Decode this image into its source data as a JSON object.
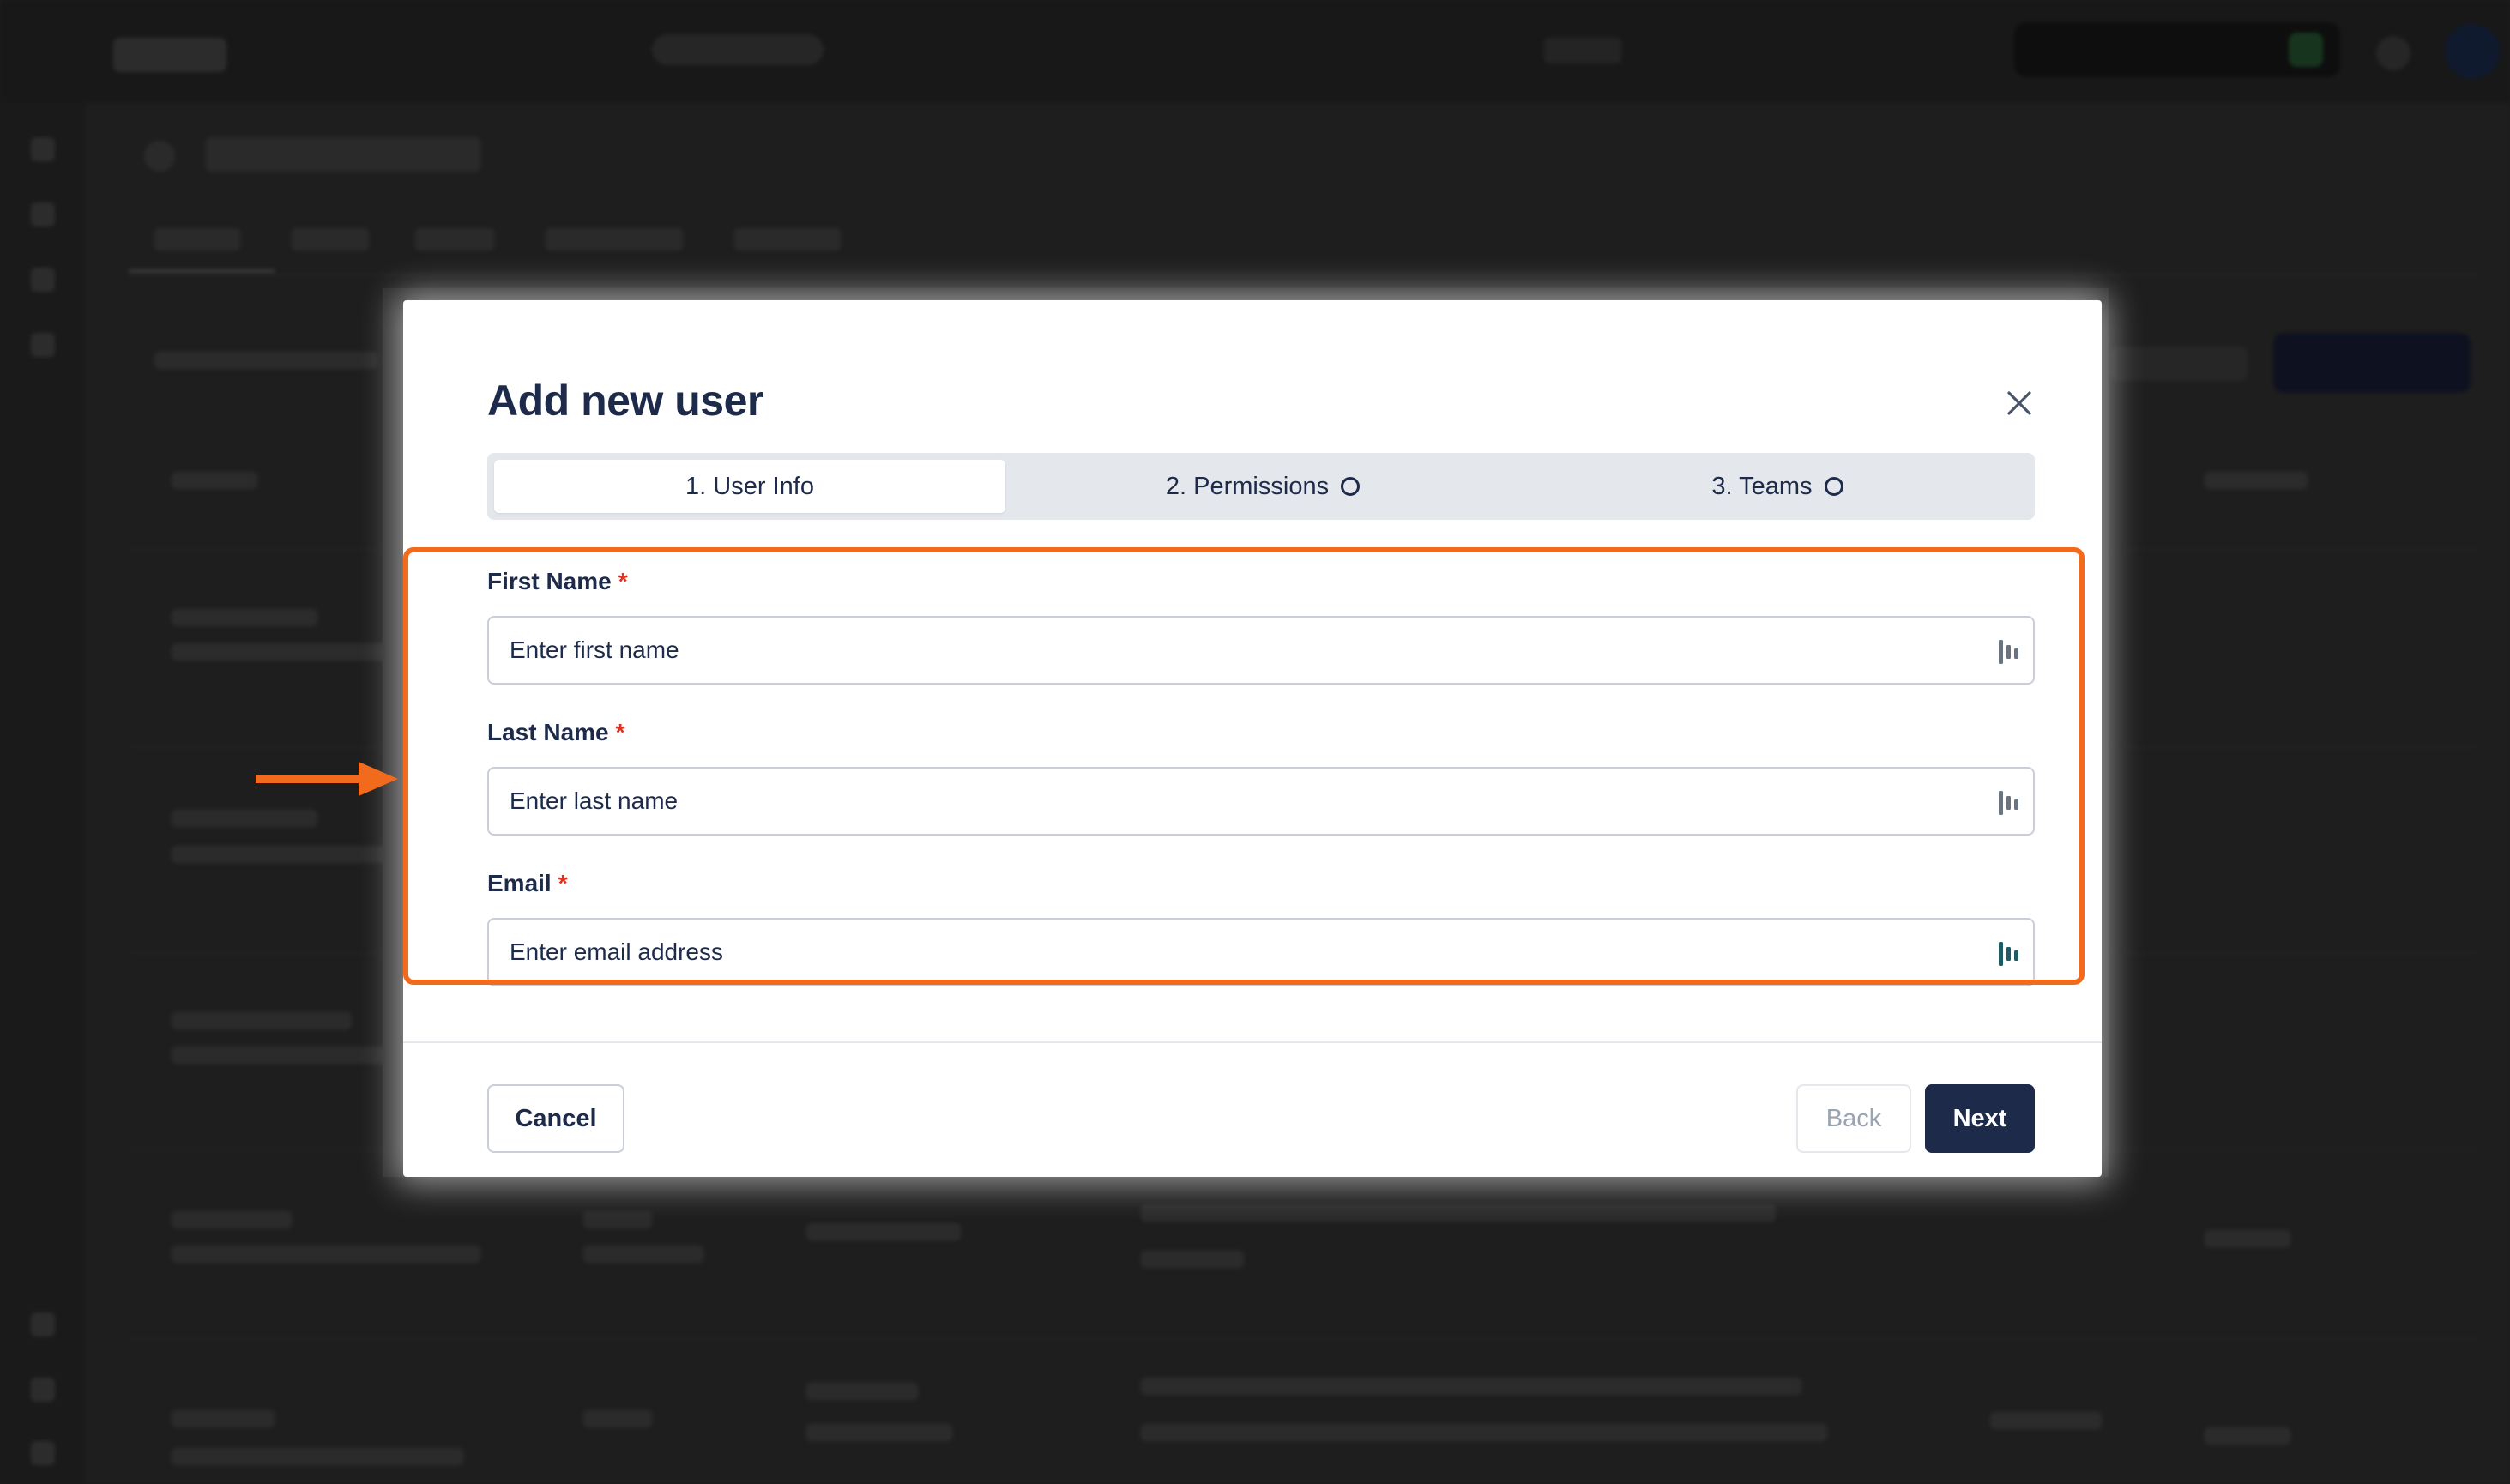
{
  "modal": {
    "title": "Add new user",
    "close_icon": "close-icon",
    "steps": [
      {
        "label": "1. User Info",
        "active": true
      },
      {
        "label": "2. Permissions",
        "active": false
      },
      {
        "label": "3. Teams",
        "active": false
      }
    ],
    "fields": {
      "first_name": {
        "label": "First Name",
        "required_mark": "*",
        "placeholder": "Enter first name",
        "value": ""
      },
      "last_name": {
        "label": "Last Name",
        "required_mark": "*",
        "placeholder": "Enter last name",
        "value": ""
      },
      "email": {
        "label": "Email",
        "required_mark": "*",
        "placeholder": "Enter email address",
        "value": ""
      }
    },
    "field_icon": "password-manager-icon",
    "buttons": {
      "cancel": "Cancel",
      "back": "Back",
      "next": "Next"
    }
  },
  "annotation": {
    "highlight_color": "#f26a1b",
    "arrow_icon": "arrow-right-icon"
  },
  "colors": {
    "primary": "#1d2a4a",
    "required": "#e0301e",
    "border": "#c9ced8",
    "stepper_bg": "#e4e7ec",
    "overlay": "#1e1e1e"
  }
}
